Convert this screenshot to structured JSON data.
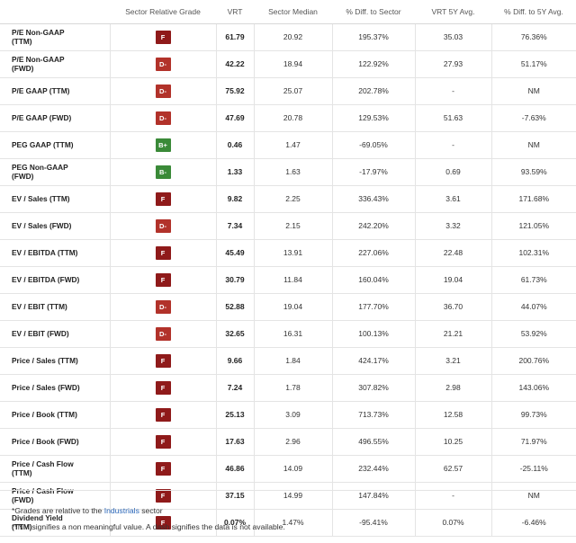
{
  "headers": {
    "metric": "",
    "grade": "Sector Relative Grade",
    "vrt": "VRT",
    "median": "Sector Median",
    "diff_sector": "% Diff. to Sector",
    "avg5y": "VRT 5Y Avg.",
    "diff5y": "% Diff. to 5Y Avg."
  },
  "rows": [
    {
      "metric": "P/E Non-GAAP (TTM)",
      "grade": "F",
      "vrt": "61.79",
      "median": "20.92",
      "diff_sector": "195.37%",
      "avg5y": "35.03",
      "diff5y": "76.36%"
    },
    {
      "metric": "P/E Non-GAAP (FWD)",
      "grade": "D-",
      "vrt": "42.22",
      "median": "18.94",
      "diff_sector": "122.92%",
      "avg5y": "27.93",
      "diff5y": "51.17%"
    },
    {
      "metric": "P/E GAAP (TTM)",
      "grade": "D-",
      "vrt": "75.92",
      "median": "25.07",
      "diff_sector": "202.78%",
      "avg5y": "-",
      "diff5y": "NM"
    },
    {
      "metric": "P/E GAAP (FWD)",
      "grade": "D-",
      "vrt": "47.69",
      "median": "20.78",
      "diff_sector": "129.53%",
      "avg5y": "51.63",
      "diff5y": "-7.63%"
    },
    {
      "metric": "PEG GAAP (TTM)",
      "grade": "B+",
      "vrt": "0.46",
      "median": "1.47",
      "diff_sector": "-69.05%",
      "avg5y": "-",
      "diff5y": "NM"
    },
    {
      "metric": "PEG Non-GAAP (FWD)",
      "grade": "B-",
      "vrt": "1.33",
      "median": "1.63",
      "diff_sector": "-17.97%",
      "avg5y": "0.69",
      "diff5y": "93.59%"
    },
    {
      "metric": "EV / Sales (TTM)",
      "grade": "F",
      "vrt": "9.82",
      "median": "2.25",
      "diff_sector": "336.43%",
      "avg5y": "3.61",
      "diff5y": "171.68%"
    },
    {
      "metric": "EV / Sales (FWD)",
      "grade": "D-",
      "vrt": "7.34",
      "median": "2.15",
      "diff_sector": "242.20%",
      "avg5y": "3.32",
      "diff5y": "121.05%"
    },
    {
      "metric": "EV / EBITDA (TTM)",
      "grade": "F",
      "vrt": "45.49",
      "median": "13.91",
      "diff_sector": "227.06%",
      "avg5y": "22.48",
      "diff5y": "102.31%"
    },
    {
      "metric": "EV / EBITDA (FWD)",
      "grade": "F",
      "vrt": "30.79",
      "median": "11.84",
      "diff_sector": "160.04%",
      "avg5y": "19.04",
      "diff5y": "61.73%"
    },
    {
      "metric": "EV / EBIT (TTM)",
      "grade": "D-",
      "vrt": "52.88",
      "median": "19.04",
      "diff_sector": "177.70%",
      "avg5y": "36.70",
      "diff5y": "44.07%"
    },
    {
      "metric": "EV / EBIT (FWD)",
      "grade": "D-",
      "vrt": "32.65",
      "median": "16.31",
      "diff_sector": "100.13%",
      "avg5y": "21.21",
      "diff5y": "53.92%"
    },
    {
      "metric": "Price / Sales (TTM)",
      "grade": "F",
      "vrt": "9.66",
      "median": "1.84",
      "diff_sector": "424.17%",
      "avg5y": "3.21",
      "diff5y": "200.76%"
    },
    {
      "metric": "Price / Sales (FWD)",
      "grade": "F",
      "vrt": "7.24",
      "median": "1.78",
      "diff_sector": "307.82%",
      "avg5y": "2.98",
      "diff5y": "143.06%"
    },
    {
      "metric": "Price / Book (TTM)",
      "grade": "F",
      "vrt": "25.13",
      "median": "3.09",
      "diff_sector": "713.73%",
      "avg5y": "12.58",
      "diff5y": "99.73%"
    },
    {
      "metric": "Price / Book (FWD)",
      "grade": "F",
      "vrt": "17.63",
      "median": "2.96",
      "diff_sector": "496.55%",
      "avg5y": "10.25",
      "diff5y": "71.97%"
    },
    {
      "metric": "Price / Cash Flow (TTM)",
      "grade": "F",
      "vrt": "46.86",
      "median": "14.09",
      "diff_sector": "232.44%",
      "avg5y": "62.57",
      "diff5y": "-25.11%"
    },
    {
      "metric": "Price / Cash Flow (FWD)",
      "grade": "F",
      "vrt": "37.15",
      "median": "14.99",
      "diff_sector": "147.84%",
      "avg5y": "-",
      "diff5y": "NM"
    },
    {
      "metric": "Dividend Yield (TTM)",
      "grade": "F",
      "vrt": "0.07%",
      "median": "1.47%",
      "diff_sector": "-95.41%",
      "avg5y": "0.07%",
      "diff5y": "-6.46%"
    }
  ],
  "grade_colors": {
    "F": "#8f1a1a",
    "D": "#b2322a",
    "B": "#3a8a38"
  },
  "footnotes": {
    "line1_prefix": "*Grades are relative to the ",
    "line1_link": "Industrials",
    "line1_suffix": " sector",
    "line2": "**NM signifies a non meaningful value. A dash signifies the data is not available."
  }
}
